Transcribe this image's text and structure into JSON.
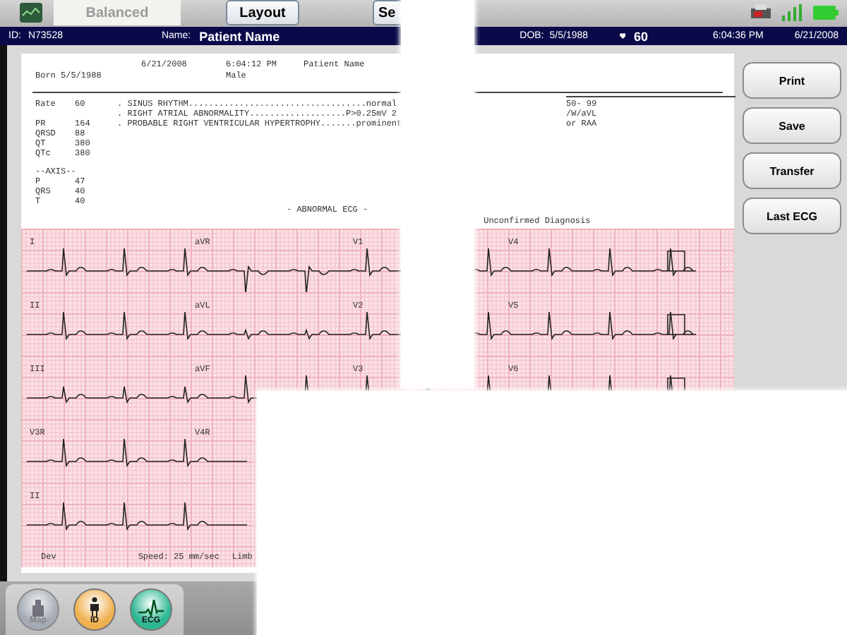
{
  "toolbar": {
    "mode": {
      "label": "Balanced",
      "disabled": true
    },
    "buttons": [
      "Layout",
      "Se"
    ]
  },
  "patient_bar": {
    "id_label": "ID:",
    "id": "N73528",
    "name_label": "Name:",
    "name": "Patient Name",
    "dob_label": "DOB:",
    "dob": "5/5/1988",
    "heart_rate": "60",
    "time": "6:04:36 PM",
    "date": "6/21/2008"
  },
  "report": {
    "date": "6/21/2008",
    "time": "6:04:12 PM",
    "name": "Patient Name",
    "born": "Born 5/5/1988",
    "sex": "Male",
    "measurements": [
      {
        "label": "Rate",
        "value": "60"
      },
      {
        "label": "PR",
        "value": "164"
      },
      {
        "label": "QRSD",
        "value": "88"
      },
      {
        "label": "QT",
        "value": "380"
      },
      {
        "label": "QTc",
        "value": "380"
      }
    ],
    "axis_title": "--AXIS--",
    "axis": [
      {
        "label": "P",
        "value": "47"
      },
      {
        "label": "QRS",
        "value": "40"
      },
      {
        "label": "T",
        "value": "40"
      }
    ],
    "statements": [
      ". SINUS RHYTHM...................................normal",
      ". RIGHT ATRIAL ABNORMALITY...................P>0.25mV 2",
      ". PROBABLE RIGHT VENTRICULAR HYPERTROPHY.......prominent"
    ],
    "statement_fragments": [
      "50- 99",
      "/W/aVL",
      "or RAA"
    ],
    "interpretation": "- ABNORMAL ECG -",
    "diagnosis_status": "Unconfirmed Diagnosis",
    "leads": [
      [
        "I",
        "aVR",
        "V1",
        "V4"
      ],
      [
        "II",
        "aVL",
        "V2",
        "V5"
      ],
      [
        "III",
        "aVF",
        "V3",
        "V6"
      ],
      [
        "V3R",
        "V4R"
      ],
      [
        "II"
      ]
    ],
    "footer": [
      "Dev",
      "Speed: 25 mm/sec",
      "Limb"
    ]
  },
  "side_buttons": [
    "Print",
    "Save",
    "Transfer",
    "Last ECG"
  ],
  "nav": [
    {
      "label": "Map",
      "kind": "map",
      "color": "#9aa3b0",
      "disabled": true
    },
    {
      "label": "ID",
      "kind": "person",
      "color": "#f0b050",
      "disabled": false
    },
    {
      "label": "ECG",
      "kind": "ecg",
      "color": "#2fb894",
      "disabled": false
    }
  ]
}
